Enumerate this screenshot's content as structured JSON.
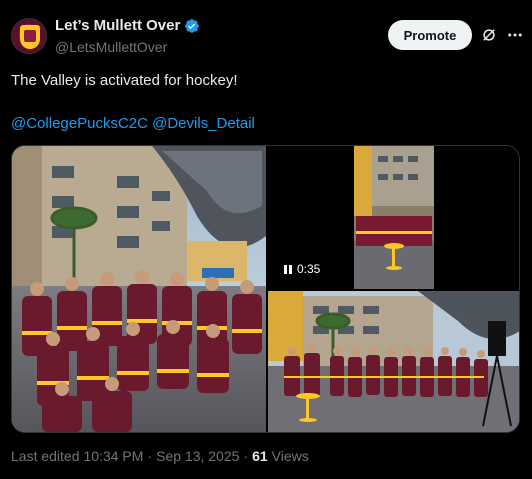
{
  "author": {
    "display_name": "Let’s Mullett Over",
    "handle": "@LetsMullettOver",
    "verified": true,
    "avatar": "sun-devil-shield-avatar"
  },
  "header": {
    "promote_label": "Promote",
    "icons": [
      "grok-icon",
      "more-icon"
    ]
  },
  "post": {
    "text": "The Valley is activated for hockey!",
    "mentions": [
      "@CollegePucksC2C",
      "@Devils_Detail"
    ]
  },
  "media": {
    "video_duration": "0:35",
    "accent_maroon": "#8c1d40",
    "accent_gold": "#ffc627"
  },
  "footer": {
    "edited_prefix": "Last edited",
    "time": "10:34 PM",
    "date": "Sep 13, 2025",
    "views_count": "61",
    "views_label": "Views"
  },
  "colors": {
    "background": "#000000",
    "text_primary": "#e7e9ea",
    "text_secondary": "#71767b",
    "link": "#1d9bf0",
    "border": "#2f3336"
  }
}
